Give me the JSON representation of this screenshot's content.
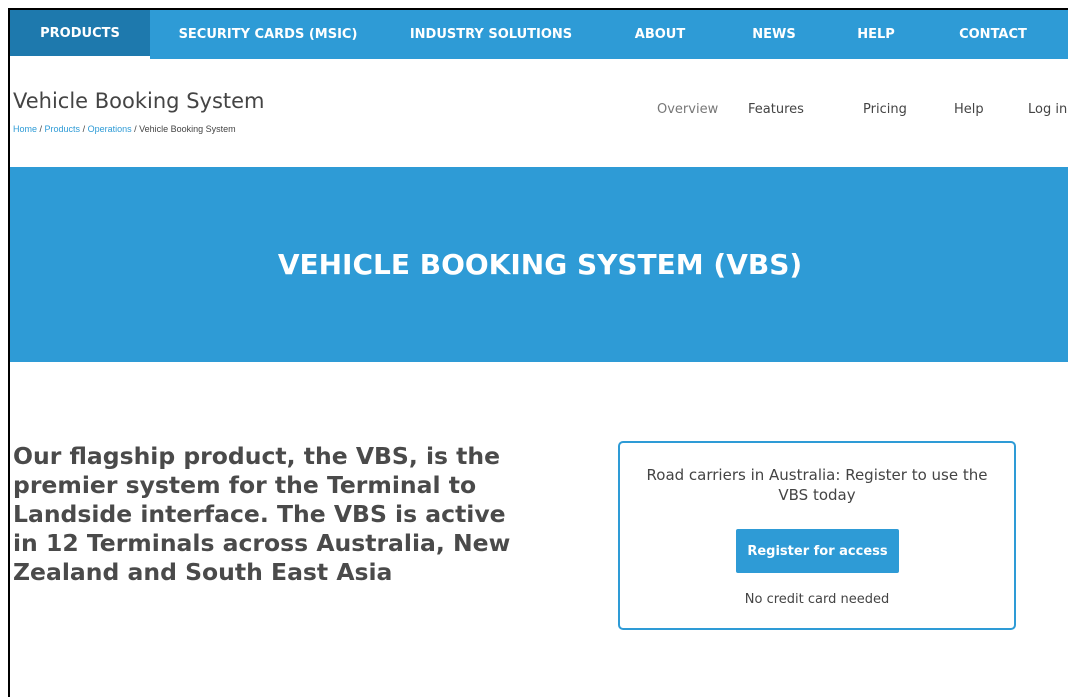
{
  "topnav": {
    "items": [
      {
        "label": "PRODUCTS",
        "active": true
      },
      {
        "label": "SECURITY CARDS (MSIC)"
      },
      {
        "label": "INDUSTRY SOLUTIONS"
      },
      {
        "label": "ABOUT"
      },
      {
        "label": "NEWS"
      },
      {
        "label": "HELP"
      },
      {
        "label": "CONTACT"
      }
    ]
  },
  "header": {
    "title": "Vehicle Booking System",
    "breadcrumb": [
      {
        "label": "Home",
        "link": true
      },
      {
        "label": "Products",
        "link": true
      },
      {
        "label": "Operations",
        "link": true
      },
      {
        "label": "Vehicle Booking System",
        "link": false
      }
    ],
    "subnav": [
      {
        "label": "Overview"
      },
      {
        "label": "Features"
      },
      {
        "label": "Pricing"
      },
      {
        "label": "Help"
      },
      {
        "label": "Log in"
      }
    ]
  },
  "hero": {
    "title": "VEHICLE BOOKING SYSTEM (VBS)"
  },
  "lead": {
    "text": "Our flagship product, the VBS, is the premier system for the Terminal to Landside interface. The VBS is active in 12 Terminals across Australia, New Zealand and South East Asia"
  },
  "cta": {
    "message": "Road carriers in Australia: Register to use the VBS today",
    "button_label": "Register for access",
    "note": "No credit card needed"
  },
  "colors": {
    "accent": "#2e9bd6",
    "accent_dark": "#1e79ad",
    "text": "#444444"
  }
}
